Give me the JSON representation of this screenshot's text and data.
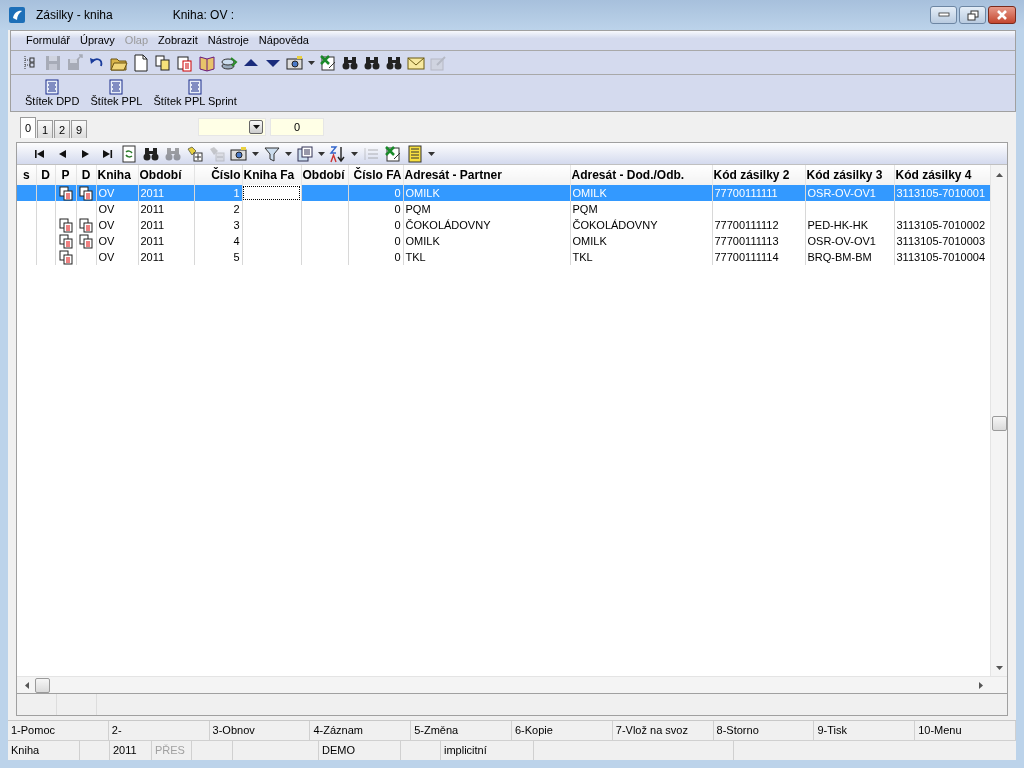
{
  "window": {
    "title": "Zásilky - kniha",
    "subtitle": "Kniha: OV :"
  },
  "menu": [
    {
      "label": "Formulář",
      "disabled": false
    },
    {
      "label": "Úpravy",
      "disabled": false
    },
    {
      "label": "Olap",
      "disabled": true
    },
    {
      "label": "Zobrazit",
      "disabled": false
    },
    {
      "label": "Nástroje",
      "disabled": false
    },
    {
      "label": "Nápověda",
      "disabled": false
    }
  ],
  "toolbar": [
    {
      "kind": "tree",
      "disabled": false
    },
    {
      "kind": "save",
      "disabled": true
    },
    {
      "kind": "saveas",
      "disabled": true
    },
    {
      "kind": "undo",
      "disabled": false
    },
    {
      "kind": "folder",
      "disabled": false
    },
    {
      "kind": "page",
      "disabled": false
    },
    {
      "kind": "copy",
      "disabled": false
    },
    {
      "kind": "paste",
      "disabled": false
    },
    {
      "kind": "book",
      "disabled": false
    },
    {
      "kind": "stack",
      "disabled": false
    },
    {
      "kind": "up",
      "disabled": false
    },
    {
      "kind": "down",
      "disabled": false
    },
    {
      "kind": "camera",
      "disabled": false,
      "dropdown": true
    },
    {
      "kind": "excel",
      "disabled": false
    },
    {
      "kind": "binoculars",
      "disabled": false
    },
    {
      "kind": "binoculars",
      "disabled": false
    },
    {
      "kind": "binoculars",
      "disabled": false
    },
    {
      "kind": "mail",
      "disabled": false
    },
    {
      "kind": "edit",
      "disabled": true
    }
  ],
  "label_buttons": [
    "Štítek DPD",
    "Štítek PPL",
    "Štítek PPL Sprint"
  ],
  "tabs": [
    {
      "label": "0",
      "selected": true
    },
    {
      "label": "1",
      "selected": false
    },
    {
      "label": "2",
      "selected": false
    },
    {
      "label": "9",
      "selected": false
    }
  ],
  "number_field": {
    "value": "0"
  },
  "grid_toolbar": [
    {
      "kind": "first",
      "disabled": false
    },
    {
      "kind": "prev",
      "disabled": false
    },
    {
      "kind": "next",
      "disabled": false
    },
    {
      "kind": "last",
      "disabled": false
    },
    {
      "kind": "refresh",
      "disabled": false
    },
    {
      "kind": "binoculars",
      "disabled": false
    },
    {
      "kind": "binoculars",
      "disabled": true
    },
    {
      "kind": "add",
      "disabled": false
    },
    {
      "kind": "remove",
      "disabled": true
    },
    {
      "kind": "camera",
      "disabled": false,
      "dropdown": true
    },
    {
      "kind": "filter",
      "disabled": false,
      "dropdown": true
    },
    {
      "kind": "export",
      "disabled": false,
      "dropdown": true
    },
    {
      "kind": "sort",
      "disabled": false,
      "dropdown": true
    },
    {
      "kind": "list",
      "disabled": true
    },
    {
      "kind": "excel",
      "disabled": false
    },
    {
      "kind": "columns",
      "disabled": false,
      "dropdown": true
    }
  ],
  "table": {
    "columns": [
      {
        "label": "s"
      },
      {
        "label": "D"
      },
      {
        "label": "P"
      },
      {
        "label": "D"
      },
      {
        "label": "Kniha"
      },
      {
        "label": "Období"
      },
      {
        "label": "Číslo"
      },
      {
        "label": "Kniha Fa"
      },
      {
        "label": "Období"
      },
      {
        "label": "Číslo FA"
      },
      {
        "label": "Adresát - Partner"
      },
      {
        "label": "Adresát - Dod./Odb."
      },
      {
        "label": "Kód zásilky 2"
      },
      {
        "label": "Kód zásilky 3"
      },
      {
        "label": "Kód zásilky 4"
      }
    ],
    "rows": [
      {
        "selected": true,
        "p_doc": true,
        "d_doc": true,
        "cells": [
          "",
          "",
          "",
          "",
          "OV",
          "2011",
          "1",
          "",
          "",
          "0",
          "OMILK",
          "OMILK",
          "77700111111",
          "OSR-OV-OV1",
          "3113105-7010001"
        ]
      },
      {
        "selected": false,
        "p_doc": false,
        "d_doc": false,
        "cells": [
          "",
          "",
          "",
          "",
          "OV",
          "2011",
          "2",
          "",
          "",
          "0",
          "PQM",
          "PQM",
          "",
          "",
          ""
        ]
      },
      {
        "selected": false,
        "p_doc": true,
        "d_doc": true,
        "cells": [
          "",
          "",
          "",
          "",
          "OV",
          "2011",
          "3",
          "",
          "",
          "0",
          "ČOKOLÁDOVNY",
          "ČOKOLÁDOVNY",
          "77700111112",
          "PED-HK-HK",
          "3113105-7010002"
        ]
      },
      {
        "selected": false,
        "p_doc": true,
        "d_doc": true,
        "cells": [
          "",
          "",
          "",
          "",
          "OV",
          "2011",
          "4",
          "",
          "",
          "0",
          "OMILK",
          "OMILK",
          "77700111113",
          "OSR-OV-OV1",
          "3113105-7010003"
        ]
      },
      {
        "selected": false,
        "p_doc": true,
        "d_doc": false,
        "cells": [
          "",
          "",
          "",
          "",
          "OV",
          "2011",
          "5",
          "",
          "",
          "0",
          "TKL",
          "TKL",
          "77700111114",
          "BRQ-BM-BM",
          "3113105-7010004"
        ]
      }
    ]
  },
  "function_keys": [
    "1-Pomoc",
    "2-",
    "3-Obnov",
    "4-Záznam",
    "5-Změna",
    "6-Kopie",
    "7-Vlož na svoz",
    "8-Storno",
    "9-Tisk",
    "10-Menu"
  ],
  "status_bar": [
    {
      "text": "Kniha",
      "disabled": false
    },
    {
      "text": "2011",
      "disabled": false
    },
    {
      "text": "PŘES",
      "disabled": true
    },
    {
      "text": "DEMO",
      "disabled": false
    },
    {
      "text": "implicitní",
      "disabled": false
    }
  ]
}
